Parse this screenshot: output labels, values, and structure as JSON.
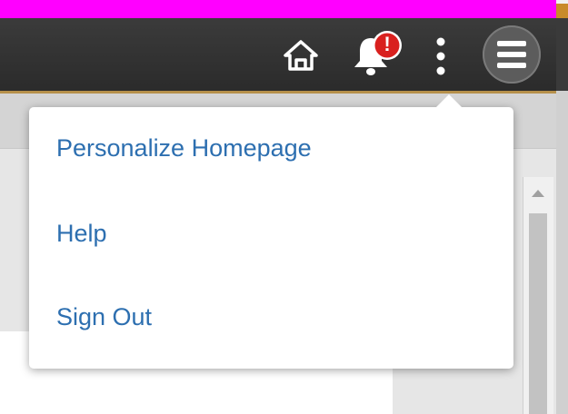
{
  "header": {
    "icons": [
      "home-icon",
      "bell-icon",
      "more-vertical-icon",
      "menu-icon"
    ],
    "notification_badge": "!",
    "colors": {
      "header_bg": "#333333",
      "top_bar": "#ff00ff",
      "badge": "#d9201e",
      "link": "#2d6fb0"
    }
  },
  "dropdown": {
    "items": [
      {
        "label": "Personalize Homepage"
      },
      {
        "label": "Help"
      },
      {
        "label": "Sign Out"
      }
    ]
  }
}
